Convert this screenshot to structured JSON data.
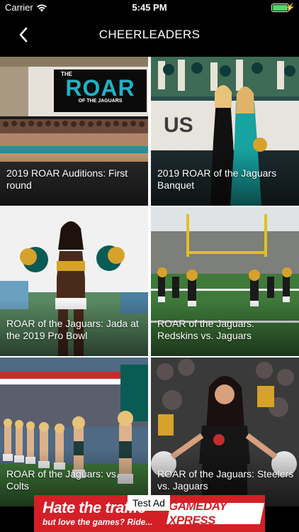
{
  "status_bar": {
    "carrier": "Carrier",
    "time": "5:45 PM",
    "icons": [
      "wifi-icon",
      "battery-icon",
      "charging-icon"
    ]
  },
  "nav": {
    "title": "CHEERLEADERS",
    "back_icon": "chevron-left-icon"
  },
  "gallery": {
    "items": [
      {
        "caption": "2019 ROAR Auditions: First round",
        "sign_line1": "THE",
        "sign_line2": "ROAR",
        "sign_line3": "OF THE JAGUARS"
      },
      {
        "caption": "2019 ROAR of the Jaguars Banquet",
        "sign_text": "US"
      },
      {
        "caption": "ROAR of the Jaguars: Jada at the 2019 Pro Bowl"
      },
      {
        "caption": "ROAR of the Jaguars: Redskins vs. Jaguars"
      },
      {
        "caption": "ROAR of the Jaguars: vs. Colts"
      },
      {
        "caption": "ROAR of the Jaguars: Steelers vs. Jaguars"
      }
    ]
  },
  "ad": {
    "label": "Test Ad",
    "headline": "Hate the traffic",
    "subline": "but love the games? Ride...",
    "brand": "GAMEDAY XPRESS"
  },
  "colors": {
    "background": "#000000",
    "ad_red": "#d41f26",
    "battery_green": "#4cd964",
    "jaguars_teal": "#006778",
    "jaguars_gold": "#d7a22a"
  }
}
